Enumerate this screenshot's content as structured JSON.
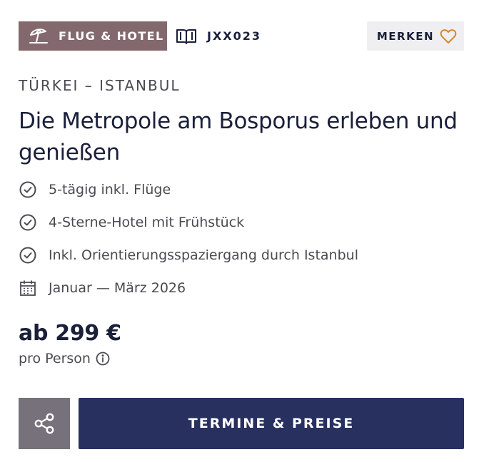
{
  "badge": {
    "label": "FLUG & HOTEL",
    "icon": "beach-umbrella-icon",
    "color": "#83696d"
  },
  "code": {
    "label": "JXX023",
    "icon": "book-icon"
  },
  "merken": {
    "label": "MERKEN",
    "icon": "heart-icon",
    "icon_color": "#d18a2e"
  },
  "region": "TÜRKEI – ISTANBUL",
  "title": "Die Metropole am Bosporus erleben und genießen",
  "features": [
    {
      "icon": "check-circle-icon",
      "text": "5-tägig inkl. Flüge"
    },
    {
      "icon": "check-circle-icon",
      "text": "4-Sterne-Hotel mit Frühstück"
    },
    {
      "icon": "check-circle-icon",
      "text": "Inkl. Orientierungsspaziergang durch Istanbul"
    },
    {
      "icon": "calendar-icon",
      "text": "Januar — März 2026"
    }
  ],
  "price": {
    "amount": "ab 299 €",
    "per": "pro Person"
  },
  "actions": {
    "share_icon": "share-icon",
    "cta_label": "TERMINE & PREISE",
    "cta_color": "#283060"
  }
}
